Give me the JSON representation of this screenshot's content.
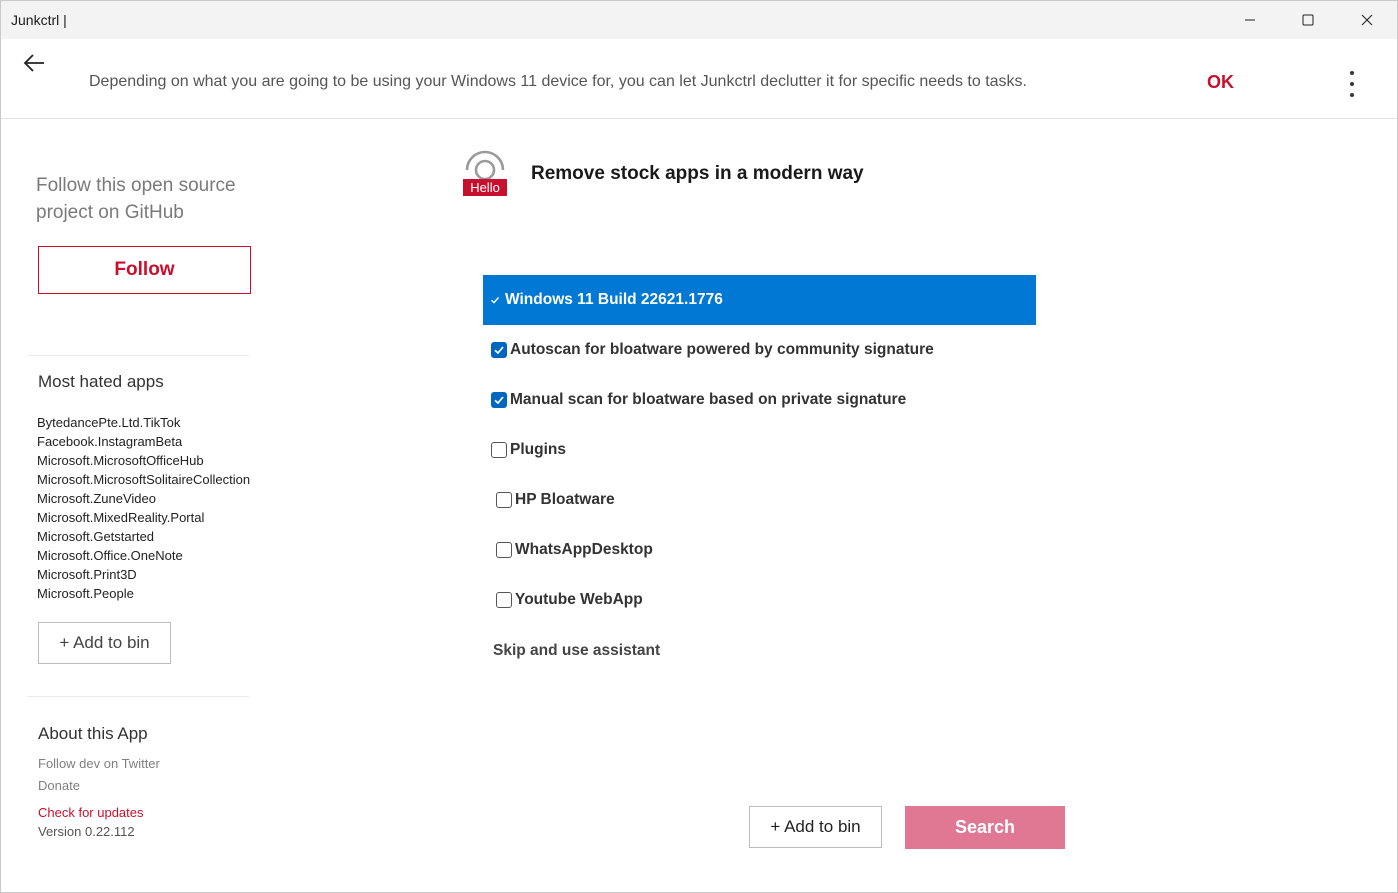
{
  "window": {
    "title": "Junkctrl  |"
  },
  "header": {
    "message": "Depending on what you are going to be using your Windows 11 device for, you can let Junkctrl declutter it for specific needs to tasks.",
    "ok_label": "OK"
  },
  "sidebar": {
    "follow_text": "Follow this open source project on GitHub",
    "follow_label": "Follow",
    "hated_title": "Most hated apps",
    "hated_apps": [
      "BytedancePte.Ltd.TikTok",
      "Facebook.InstagramBeta",
      "Microsoft.MicrosoftOfficeHub",
      "Microsoft.MicrosoftSolitaireCollection",
      "Microsoft.ZuneVideo",
      "Microsoft.MixedReality.Portal",
      "Microsoft.Getstarted",
      "Microsoft.Office.OneNote",
      "Microsoft.Print3D",
      "Microsoft.People"
    ],
    "add_label": "+ Add to bin",
    "about_title": "About this App",
    "twitter_label": "Follow dev on Twitter",
    "donate_label": "Donate",
    "update_label": "Check for updates",
    "version_label": "Version 0.22.112"
  },
  "main": {
    "logo_badge": "Hello",
    "title": "Remove stock apps in a modern way",
    "options": [
      {
        "label": "Windows 11 Build 22621.1776",
        "checked": true,
        "selected": true
      },
      {
        "label": "Autoscan for bloatware powered by community signature",
        "checked": true,
        "selected": false
      },
      {
        "label": "Manual scan for bloatware based on private signature",
        "checked": true,
        "selected": false
      },
      {
        "label": "Plugins",
        "checked": false,
        "selected": false
      },
      {
        "label": "HP Bloatware",
        "checked": false,
        "selected": false
      },
      {
        "label": "WhatsAppDesktop",
        "checked": false,
        "selected": false
      },
      {
        "label": "Youtube WebApp",
        "checked": false,
        "selected": false
      }
    ],
    "skip_label": "Skip and use assistant",
    "add_label": "+ Add to bin",
    "search_label": "Search"
  },
  "colors": {
    "accent": "#c8102e",
    "selection": "#0078d4",
    "search_button": "#e07894"
  }
}
